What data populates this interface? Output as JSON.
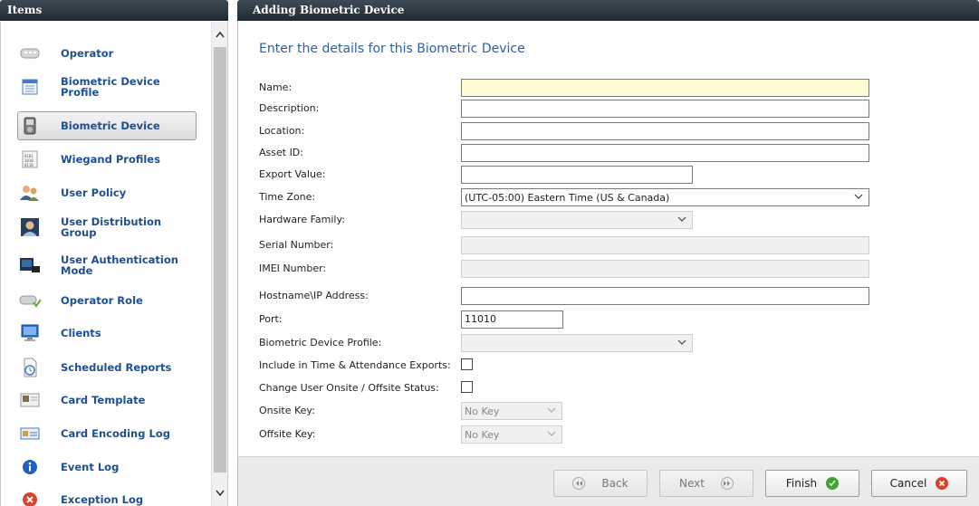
{
  "left_panel": {
    "title": "Items",
    "items": [
      {
        "label": "Operator",
        "icon": "operator-icon"
      },
      {
        "label": "Biometric Device Profile",
        "icon": "device-profile-icon"
      },
      {
        "label": "Biometric Device",
        "icon": "biometric-device-icon",
        "selected": true
      },
      {
        "label": "Wiegand Profiles",
        "icon": "wiegand-icon"
      },
      {
        "label": "User Policy",
        "icon": "user-policy-icon"
      },
      {
        "label": "User Distribution Group",
        "icon": "distribution-group-icon"
      },
      {
        "label": "User Authentication Mode",
        "icon": "authentication-mode-icon"
      },
      {
        "label": "Operator Role",
        "icon": "operator-role-icon"
      },
      {
        "label": "Clients",
        "icon": "clients-icon"
      },
      {
        "label": "Scheduled Reports",
        "icon": "scheduled-reports-icon"
      },
      {
        "label": "Card Template",
        "icon": "card-template-icon"
      },
      {
        "label": "Card Encoding Log",
        "icon": "card-encoding-icon"
      },
      {
        "label": "Event Log",
        "icon": "event-log-icon"
      },
      {
        "label": "Exception Log",
        "icon": "exception-log-icon"
      }
    ]
  },
  "right_panel": {
    "title": "Adding Biometric Device",
    "heading": "Enter the details for this Biometric Device",
    "fields": {
      "name": {
        "label": "Name:",
        "value": ""
      },
      "description": {
        "label": "Description:",
        "value": ""
      },
      "location": {
        "label": "Location:",
        "value": ""
      },
      "asset_id": {
        "label": "Asset ID:",
        "value": ""
      },
      "export_value": {
        "label": "Export Value:",
        "value": ""
      },
      "time_zone": {
        "label": "Time Zone:",
        "value": "(UTC-05:00) Eastern Time (US & Canada)"
      },
      "hardware_family": {
        "label": "Hardware Family:",
        "value": ""
      },
      "serial_number": {
        "label": "Serial Number:",
        "value": ""
      },
      "imei_number": {
        "label": "IMEI Number:",
        "value": ""
      },
      "hostname": {
        "label": "Hostname\\IP Address:",
        "value": ""
      },
      "port": {
        "label": "Port:",
        "value": "11010"
      },
      "device_profile": {
        "label": "Biometric Device Profile:",
        "value": ""
      },
      "include_exports": {
        "label": "Include in Time & Attendance Exports:",
        "checked": false
      },
      "change_status": {
        "label": "Change User Onsite / Offsite Status:",
        "checked": false
      },
      "onsite_key": {
        "label": "Onsite Key:",
        "value": "No Key"
      },
      "offsite_key": {
        "label": "Offsite Key:",
        "value": "No Key"
      }
    }
  },
  "footer": {
    "back_label": "Back",
    "next_label": "Next",
    "finish_label": "Finish",
    "cancel_label": "Cancel"
  },
  "colors": {
    "header_bg": "#2a353e",
    "link_blue": "#1d4f91",
    "heading_blue": "#2d5fa3",
    "name_field_bg": "#fdfbd2",
    "finish_green": "#3aa62b",
    "cancel_red": "#d8442b"
  }
}
